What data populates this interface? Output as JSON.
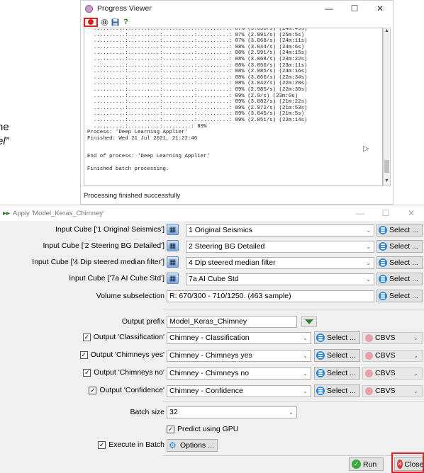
{
  "background_text": {
    "line1": "ne",
    "line2": "el”"
  },
  "progress_viewer": {
    "title": "Progress Viewer",
    "controls": {
      "minimize": "—",
      "maximize": "☐",
      "close": "✕"
    },
    "toolbar": {
      "help": "?"
    },
    "log_text": "  ..........:..........:..........:..........: 87% (3.058/s) (24m:49s)\n  ..........:..........:..........:..........: 87% (2.991/s) (25m:5s)\n  ..........:..........:..........:..........: 87% (3.068/s) (24m:11s)\n  ..........:..........:..........:..........: 88% (3.044/s) (24m:6s)\n  ..........:..........:..........:..........: 88% (2.991/s) (24m:15s)\n  ..........:..........:..........:..........: 88% (3.068/s) (23m:22s)\n  ..........:..........:..........:..........: 88% (3.056/s) (23m:11s)\n  ..........:..........:..........:..........: 88% (2.885/s) (24m:16s)\n  ..........:..........:..........:..........: 88% (3.066/s) (22m:34s)\n  ..........:..........:..........:..........: 88% (3.042/s) (22m:28s)\n  ..........:..........:..........:..........: 89% (2.985/s) (22m:38s)\n  ..........:..........:..........:..........: 89% (2.9/s) (23m:0s)\n  ..........:..........:..........:..........: 89% (3.082/s) (21m:22s)\n  ..........:..........:..........:..........: 89% (2.972/s) (21m:53s)\n  ..........:..........:..........:..........: 89% (3.045/s) (21m:5s)\n  ..........:..........:..........:..........: 89% (2.851/s) (22m:14s)\n  ..........:..........:.........: 89%\nProcess: 'Deep Learning Applier'\nFinished: Wed 21 Jul 2021, 21:22:46\n\n\nEnd of process: 'Deep Learning Applier'\n\nFinished batch processing.",
    "status": "Processing finished successfully"
  },
  "apply_window": {
    "title": "Apply 'Model_Keras_Chimney'",
    "controls": {
      "minimize": "—",
      "maximize": "☐",
      "close": "✕"
    },
    "inputs": [
      {
        "label": "Input Cube ['1 Original Seismics']",
        "value": "1 Original Seismics",
        "button": "Select ..."
      },
      {
        "label": "Input Cube ['2 Steering BG Detailed']",
        "value": "2 Steering BG Detailed",
        "button": "Select ..."
      },
      {
        "label": "Input Cube ['4 Dip steered median filter']",
        "value": "4 Dip steered median filter",
        "button": "Select ..."
      },
      {
        "label": "Input Cube ['7a AI Cube Std']",
        "value": "7a AI Cube Std",
        "button": "Select ..."
      }
    ],
    "volume": {
      "label": "Volume subselection",
      "value": "R: 670/300 - 710/1250.  (463 sample)",
      "button": "Select ..."
    },
    "prefix": {
      "label": "Output prefix",
      "value": "Model_Keras_Chimney"
    },
    "outputs": [
      {
        "label": "Output 'Classification'",
        "value": "Chimney - Classification",
        "button": "Select ...",
        "cbvs": "CBVS",
        "checked": true
      },
      {
        "label": "Output 'Chimneys yes'",
        "value": "Chimney - Chimneys yes",
        "button": "Select ...",
        "cbvs": "CBVS",
        "checked": true
      },
      {
        "label": "Output 'Chimneys no'",
        "value": "Chimney - Chimneys no",
        "button": "Select ...",
        "cbvs": "CBVS",
        "checked": true
      },
      {
        "label": "Output 'Confidence'",
        "value": "Chimney - Confidence",
        "button": "Select ...",
        "cbvs": "CBVS",
        "checked": true
      }
    ],
    "batch": {
      "label": "Batch size",
      "value": "32"
    },
    "gpu": {
      "label": "Predict using GPU",
      "checked": true
    },
    "execute": {
      "label": "Execute in Batch",
      "checked": true,
      "options_label": "Options ..."
    },
    "run_label": "Run",
    "close_label": "Close"
  }
}
